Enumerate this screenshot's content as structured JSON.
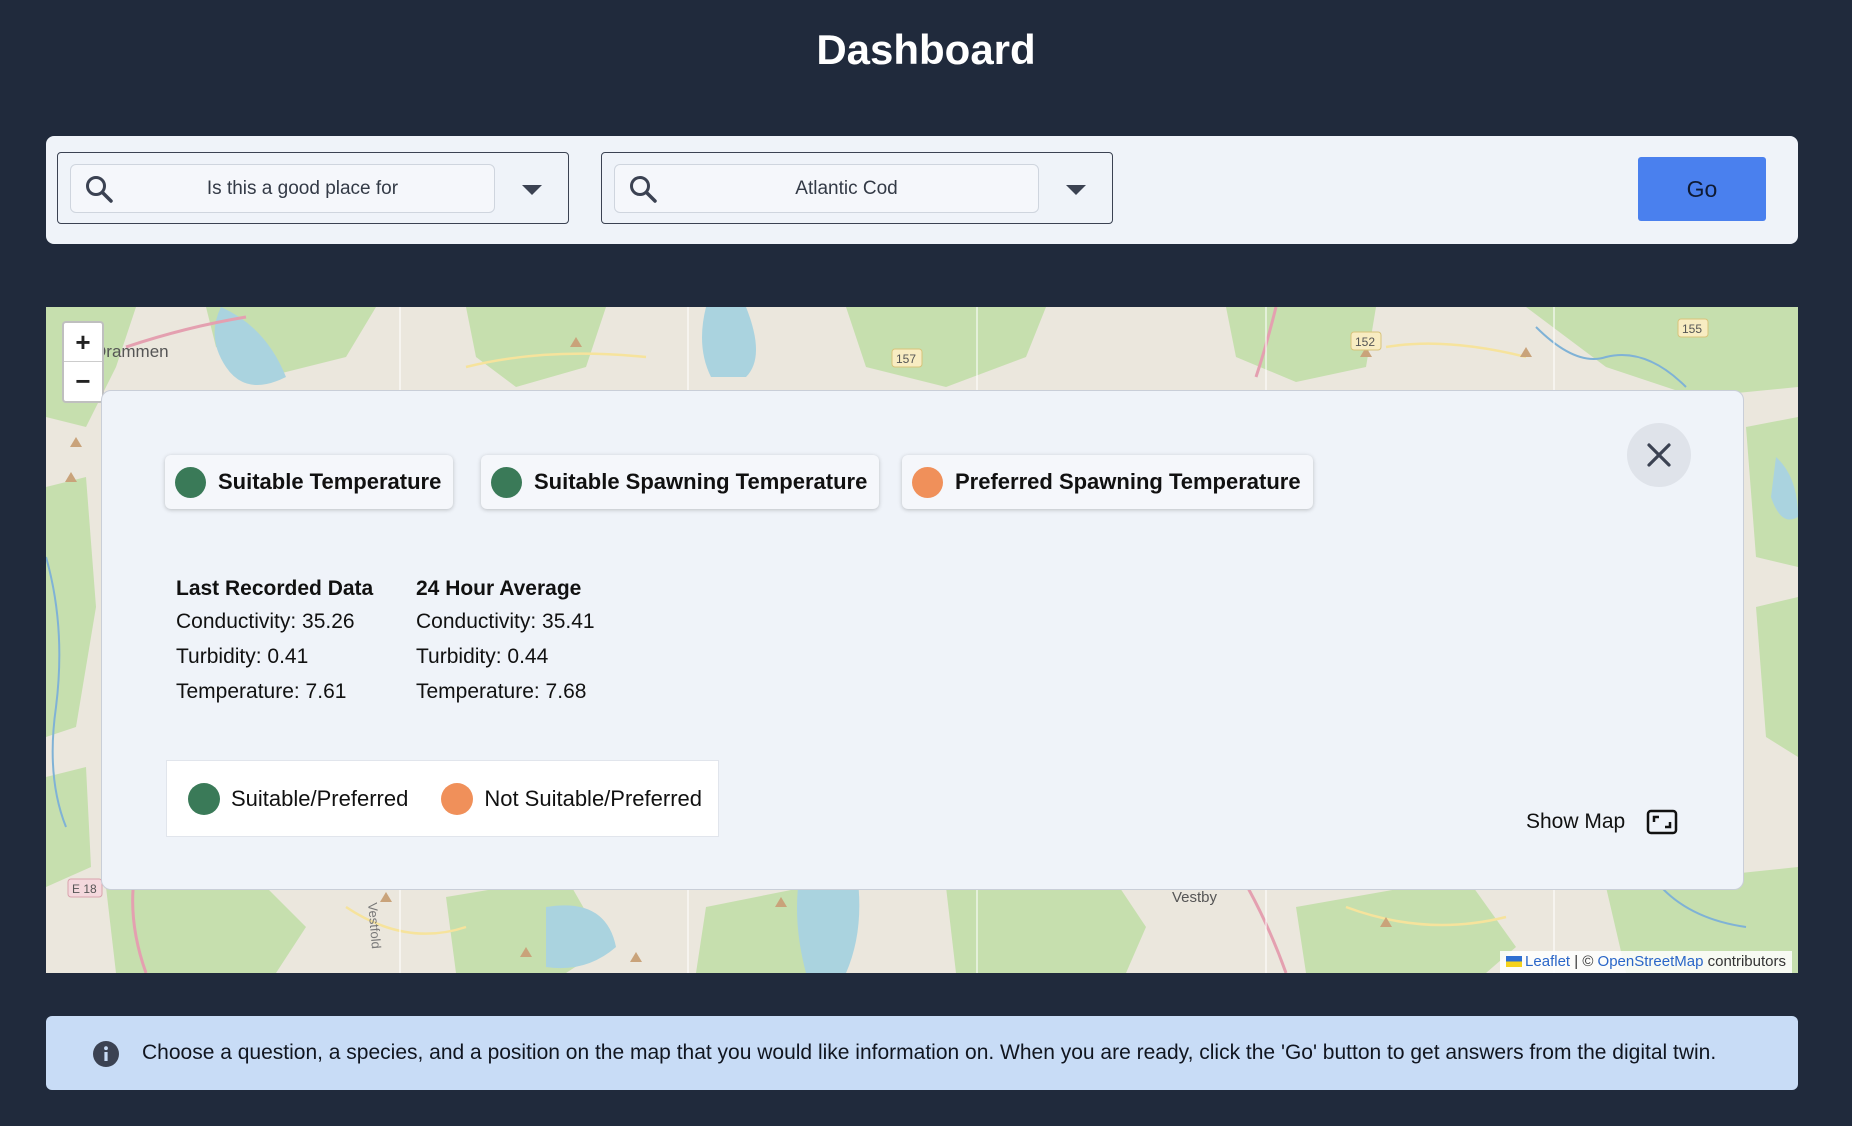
{
  "page": {
    "title": "Dashboard"
  },
  "controls": {
    "question": {
      "value": "Is this a good place for",
      "icon": "search-icon"
    },
    "species": {
      "value": "Atlantic Cod",
      "icon": "search-icon"
    },
    "go_label": "Go"
  },
  "map": {
    "place_labels": {
      "drammen": "Drammen",
      "vestby": "Vestby",
      "vestfold": "Vestfold",
      "e18": "E 18",
      "r157": "157",
      "r152": "152",
      "r155": "155"
    },
    "zoom_in": "+",
    "zoom_out": "−",
    "attribution": {
      "leaflet": "Leaflet",
      "sep": " | © ",
      "osm": "OpenStreetMap",
      "suffix": " contributors"
    }
  },
  "panel": {
    "chips": [
      {
        "label": "Suitable Temperature",
        "status": "suitable"
      },
      {
        "label": "Suitable Spawning Temperature",
        "status": "suitable"
      },
      {
        "label": "Preferred Spawning Temperature",
        "status": "not_suitable"
      }
    ],
    "last_recorded": {
      "heading": "Last Recorded Data",
      "conductivity": "Conductivity: 35.26",
      "turbidity": "Turbidity: 0.41",
      "temperature": "Temperature: 7.61"
    },
    "average_24h": {
      "heading": "24 Hour Average",
      "conductivity": "Conductivity: 35.41",
      "turbidity": "Turbidity: 0.44",
      "temperature": "Temperature: 7.68"
    },
    "legend": [
      {
        "label": "Suitable/Preferred"
      },
      {
        "label": "Not Suitable/Preferred"
      }
    ],
    "show_map_label": "Show Map"
  },
  "info": {
    "message": "Choose a question, a species, and a position on the map that you would like information on. When you are ready, click the 'Go' button to get answers from the digital twin."
  },
  "colors": {
    "background": "#202a3c",
    "suitable": "#3a7a58",
    "not_suitable": "#f0905a",
    "go_button": "#4a80ee",
    "info_banner": "#c8dcf6"
  }
}
